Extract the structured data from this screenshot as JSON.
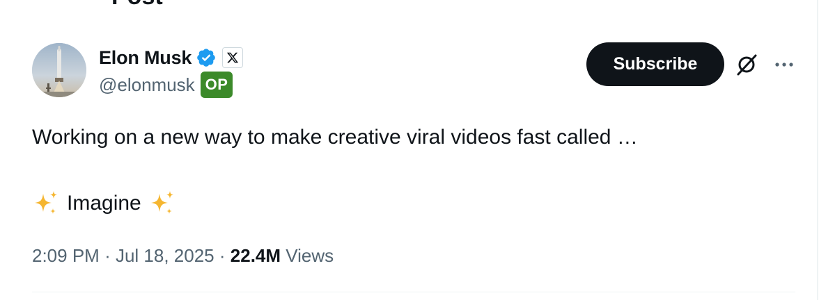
{
  "header_clipped_text": "Post",
  "author": {
    "display_name": "Elon Musk",
    "handle": "@elonmusk",
    "op_badge": "OP",
    "verified_icon": "verified-badge-icon",
    "affiliation_icon": "x-logo-icon",
    "avatar_icon": "rocket-avatar"
  },
  "actions": {
    "subscribe_label": "Subscribe",
    "grok_icon": "grok-icon",
    "more_icon": "more-options-icon"
  },
  "tweet": {
    "line1": "Working on a new way to make creative viral videos fast called …",
    "line2": "Imagine",
    "emoji": "sparkles"
  },
  "meta": {
    "time": "2:09 PM",
    "separator": "·",
    "date": "Jul 18, 2025",
    "views_count": "22.4M",
    "views_label": "Views"
  },
  "colors": {
    "text_primary": "#0f1419",
    "text_secondary": "#536471",
    "verified_blue": "#1d9bf0",
    "op_green": "#3c8a2a",
    "sparkle_gold": "#f5b631",
    "divider": "#eff3f4"
  }
}
